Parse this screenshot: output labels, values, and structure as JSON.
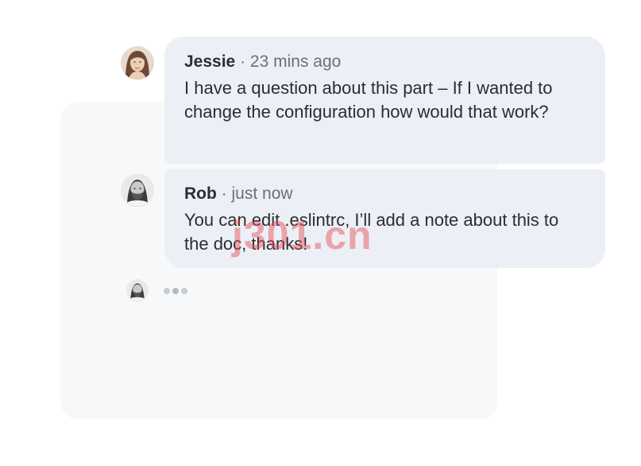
{
  "thread": {
    "messages": [
      {
        "author": "Jessie",
        "separator": "·",
        "time": "23 mins ago",
        "text": "I have a question about this part – If I wanted to change the configuration how would that work?",
        "avatar_icon": "woman-avatar"
      },
      {
        "author": "Rob",
        "separator": "·",
        "time": "just now",
        "text": "You can edit .eslintrc, I’ll add a note about this to the doc, thanks!",
        "avatar_icon": "man-avatar"
      }
    ],
    "typing_indicator": {
      "avatar_icon": "man-avatar",
      "dots": 3
    }
  },
  "watermark": {
    "text": "j301.cn",
    "color": "#e64650"
  },
  "colors": {
    "bubble_background": "#eceff5",
    "backdrop_background": "#f7f8fa",
    "author_text": "#2b2d31",
    "meta_text": "#6b6f78"
  }
}
